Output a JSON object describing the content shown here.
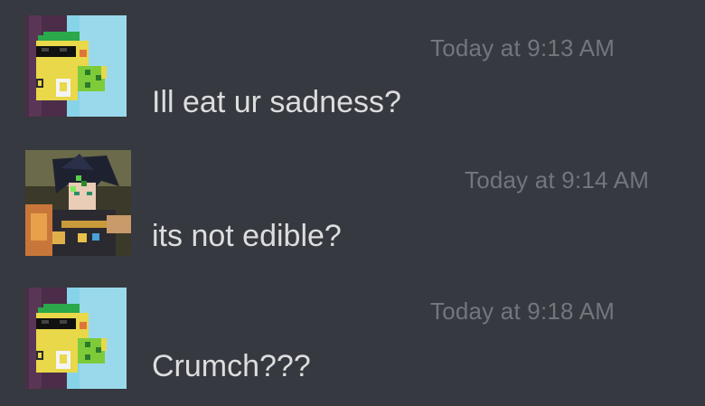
{
  "messages": [
    {
      "avatar_icon": "pixel-dino-sunglasses-avatar",
      "timestamp": "Today at 9:13 AM",
      "content": "Ill eat ur sadness?"
    },
    {
      "avatar_icon": "anime-character-avatar",
      "timestamp": "Today at 9:14 AM",
      "content": "its not edible?"
    },
    {
      "avatar_icon": "pixel-dino-sunglasses-avatar",
      "timestamp": "Today at 9:18 AM",
      "content": "Crumch???"
    }
  ],
  "colors": {
    "background": "#36393f",
    "timestamp": "#72767d",
    "message_text": "#dcddde"
  }
}
